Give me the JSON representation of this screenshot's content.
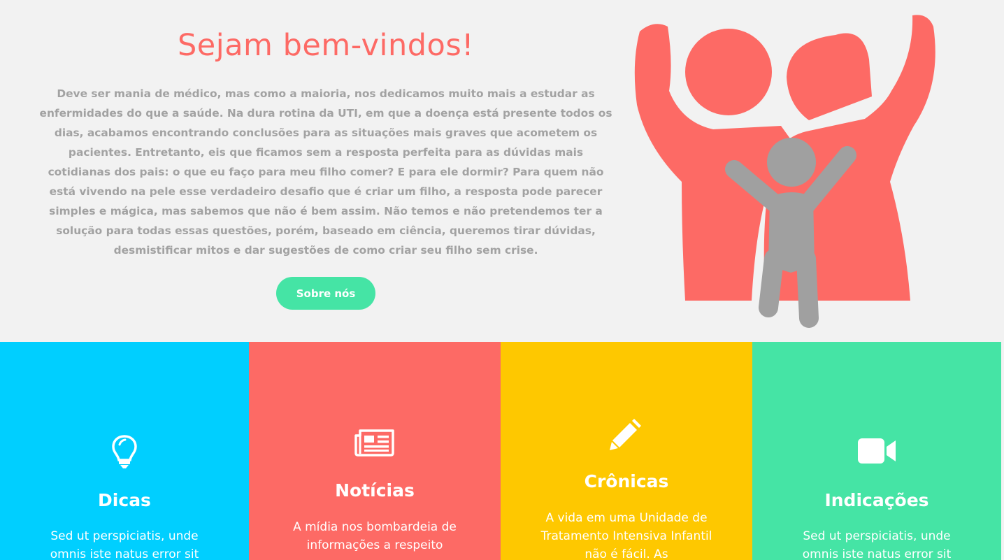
{
  "hero": {
    "title": "Sejam bem-vindos!",
    "text": "Deve ser mania de médico, mas como a maioria, nos dedicamos muito mais a estudar as enfermidades do que a saúde. Na dura rotina da UTI, em que a doença está presente todos os dias, acabamos encontrando conclusões para as situações mais graves que acometem os pacientes. Entretanto, eis que ficamos sem a resposta perfeita para as dúvidas mais cotidianas dos pais: o que eu faço para meu filho comer? E para ele dormir? Para quem não está vivendo na pele esse verdadeiro desafio que é criar um filho, a resposta pode parecer simples e mágica, mas sabemos que não é bem assim. Não temos e não pretendemos ter a solução para todas essas questões, porém, baseado em ciência, queremos tirar dúvidas, desmistificar mitos e dar sugestões de como criar seu filho sem crise.",
    "button_label": "Sobre nós",
    "illustration_icon": "family-icon"
  },
  "cards": [
    {
      "icon": "lightbulb-icon",
      "title": "Dicas",
      "text": "Sed ut perspiciatis, unde omnis iste natus error sit",
      "color": "#00cfff"
    },
    {
      "icon": "newspaper-icon",
      "title": "Notícias",
      "text": "A mídia nos bombardeia de informações a respeito",
      "color": "#fd6a65"
    },
    {
      "icon": "pencil-icon",
      "title": "Crônicas",
      "text": "A vida em uma Unidade de Tratamento Intensiva Infantil não é fácil. As",
      "color": "#fec800"
    },
    {
      "icon": "video-camera-icon",
      "title": "Indicações",
      "text": "Sed ut perspiciatis, unde omnis iste natus error sit",
      "color": "#45e4a5"
    }
  ],
  "colors": {
    "coral": "#fd6a65",
    "gray_text": "#a2a2a2",
    "green": "#45e4a5",
    "cyan": "#00cfff",
    "yellow": "#fec800",
    "child_gray": "#a0a0a0"
  }
}
